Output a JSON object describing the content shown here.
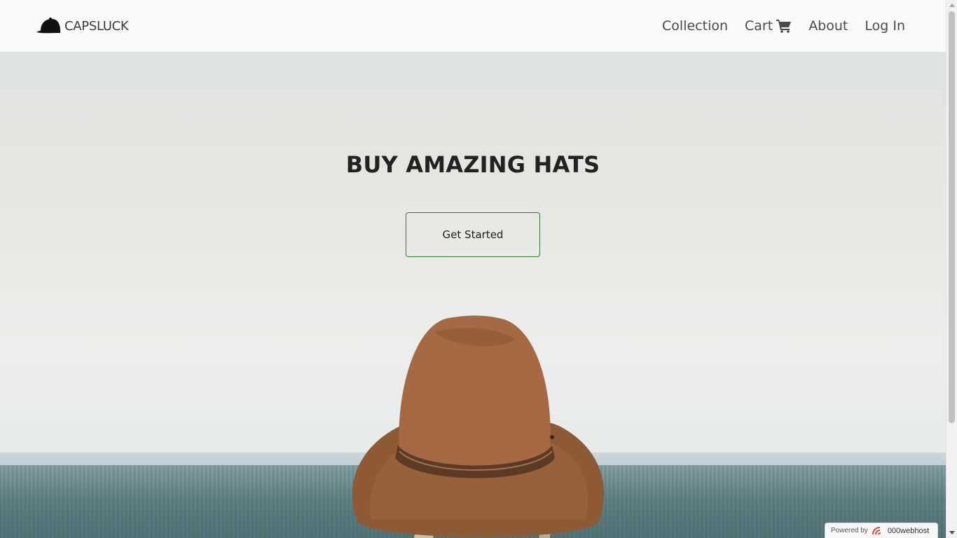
{
  "header": {
    "brand": "CAPSLUCK",
    "nav": [
      {
        "label": "Collection"
      },
      {
        "label": "Cart",
        "icon": "cart-icon"
      },
      {
        "label": "About"
      },
      {
        "label": "Log In"
      }
    ]
  },
  "hero": {
    "title": "BUY AMAZING HATS",
    "cta_label": "Get Started",
    "image": "woman-wearing-brown-fedora-hat"
  },
  "footer_badge": {
    "label": "Powered by",
    "brand": "000webhost"
  },
  "colors": {
    "navbar_bg": "#f8f9fa",
    "nav_text": "#4a4a4a",
    "cta_border": "#2e7d32",
    "title_text": "#222222"
  }
}
